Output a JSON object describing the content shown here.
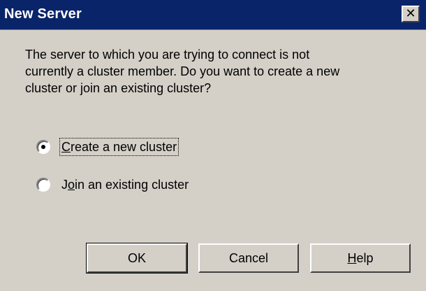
{
  "window": {
    "title": "New Server",
    "close_glyph": "✕"
  },
  "message": "The server to which you are trying to connect is not\ncurrently a cluster member.  Do you want to create a new\ncluster or join an existing cluster?",
  "options": [
    {
      "label": "Create a new cluster",
      "mnemonic": "C",
      "rest": "reate a new cluster",
      "selected": true
    },
    {
      "label": "Join an existing cluster",
      "mnemonic_pre": "J",
      "mnemonic": "o",
      "rest": "in an existing cluster",
      "selected": false
    }
  ],
  "buttons": {
    "ok": "OK",
    "cancel": "Cancel",
    "help_mnemonic": "H",
    "help_rest": "elp"
  }
}
